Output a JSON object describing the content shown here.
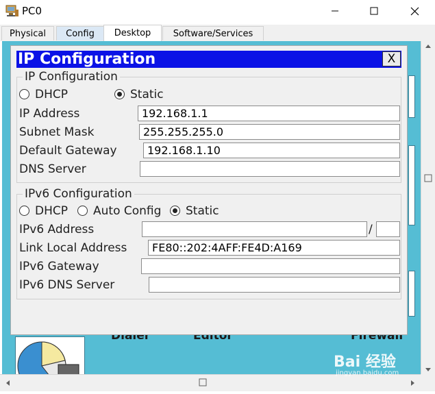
{
  "window": {
    "title": "PC0"
  },
  "tabs": [
    {
      "label": "Physical"
    },
    {
      "label": "Config"
    },
    {
      "label": "Desktop"
    },
    {
      "label": "Software/Services"
    }
  ],
  "background_apps": [
    {
      "label": "Dialer"
    },
    {
      "label": "Editor"
    },
    {
      "label": "Firewall"
    }
  ],
  "dialog": {
    "title": "IP Configuration",
    "close_label": "X",
    "ipv4": {
      "group_title": "IP Configuration",
      "mode": {
        "dhcp_label": "DHCP",
        "static_label": "Static",
        "selected": "Static"
      },
      "ip_address_label": "IP Address",
      "ip_address": "192.168.1.1",
      "subnet_mask_label": "Subnet Mask",
      "subnet_mask": "255.255.255.0",
      "default_gateway_label": "Default Gateway",
      "default_gateway": "192.168.1.10",
      "dns_server_label": "DNS Server",
      "dns_server": ""
    },
    "ipv6": {
      "group_title": "IPv6 Configuration",
      "mode": {
        "dhcp_label": "DHCP",
        "auto_label": "Auto Config",
        "static_label": "Static",
        "selected": "Static"
      },
      "ipv6_address_label": "IPv6 Address",
      "ipv6_address": "",
      "prefix_separator": "/",
      "prefix_length": "",
      "link_local_label": "Link Local Address",
      "link_local": "FE80::202:4AFF:FE4D:A169",
      "ipv6_gateway_label": "IPv6 Gateway",
      "ipv6_gateway": "",
      "ipv6_dns_label": "IPv6 DNS Server",
      "ipv6_dns": ""
    }
  },
  "watermark": {
    "text": "Bai 经验",
    "sub": "jingyan.baidu.com"
  }
}
